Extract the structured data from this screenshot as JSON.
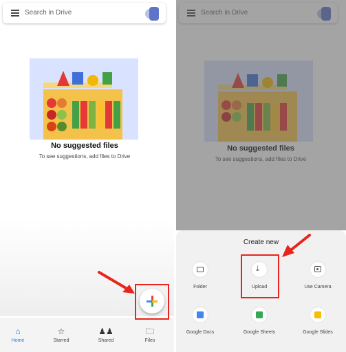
{
  "search": {
    "placeholder": "Search in Drive"
  },
  "empty_state": {
    "title": "No suggested files",
    "subtitle": "To see suggestions, add files to Drive"
  },
  "bottom_nav": {
    "items": [
      {
        "label": "Home",
        "icon": "home-icon",
        "active": true
      },
      {
        "label": "Starred",
        "icon": "star-icon",
        "active": false
      },
      {
        "label": "Shared",
        "icon": "people-icon",
        "active": false
      },
      {
        "label": "Files",
        "icon": "folder-icon",
        "active": false
      }
    ]
  },
  "fab": {
    "icon": "plus-icon",
    "colors": [
      "#ea4335",
      "#4285f4",
      "#fbbc04",
      "#34a853"
    ]
  },
  "create_sheet": {
    "title": "Create new",
    "options": [
      {
        "label": "Folder",
        "icon": "folder-icon"
      },
      {
        "label": "Upload",
        "icon": "upload-icon"
      },
      {
        "label": "Use Camera",
        "icon": "camera-icon"
      },
      {
        "label": "Google Docs",
        "icon": "docs-icon",
        "color": "#4285f4"
      },
      {
        "label": "Google Sheets",
        "icon": "sheets-icon",
        "color": "#34a853"
      },
      {
        "label": "Google Slides",
        "icon": "slides-icon",
        "color": "#fbbc04"
      }
    ]
  },
  "annotation": {
    "color": "#e8241c"
  }
}
